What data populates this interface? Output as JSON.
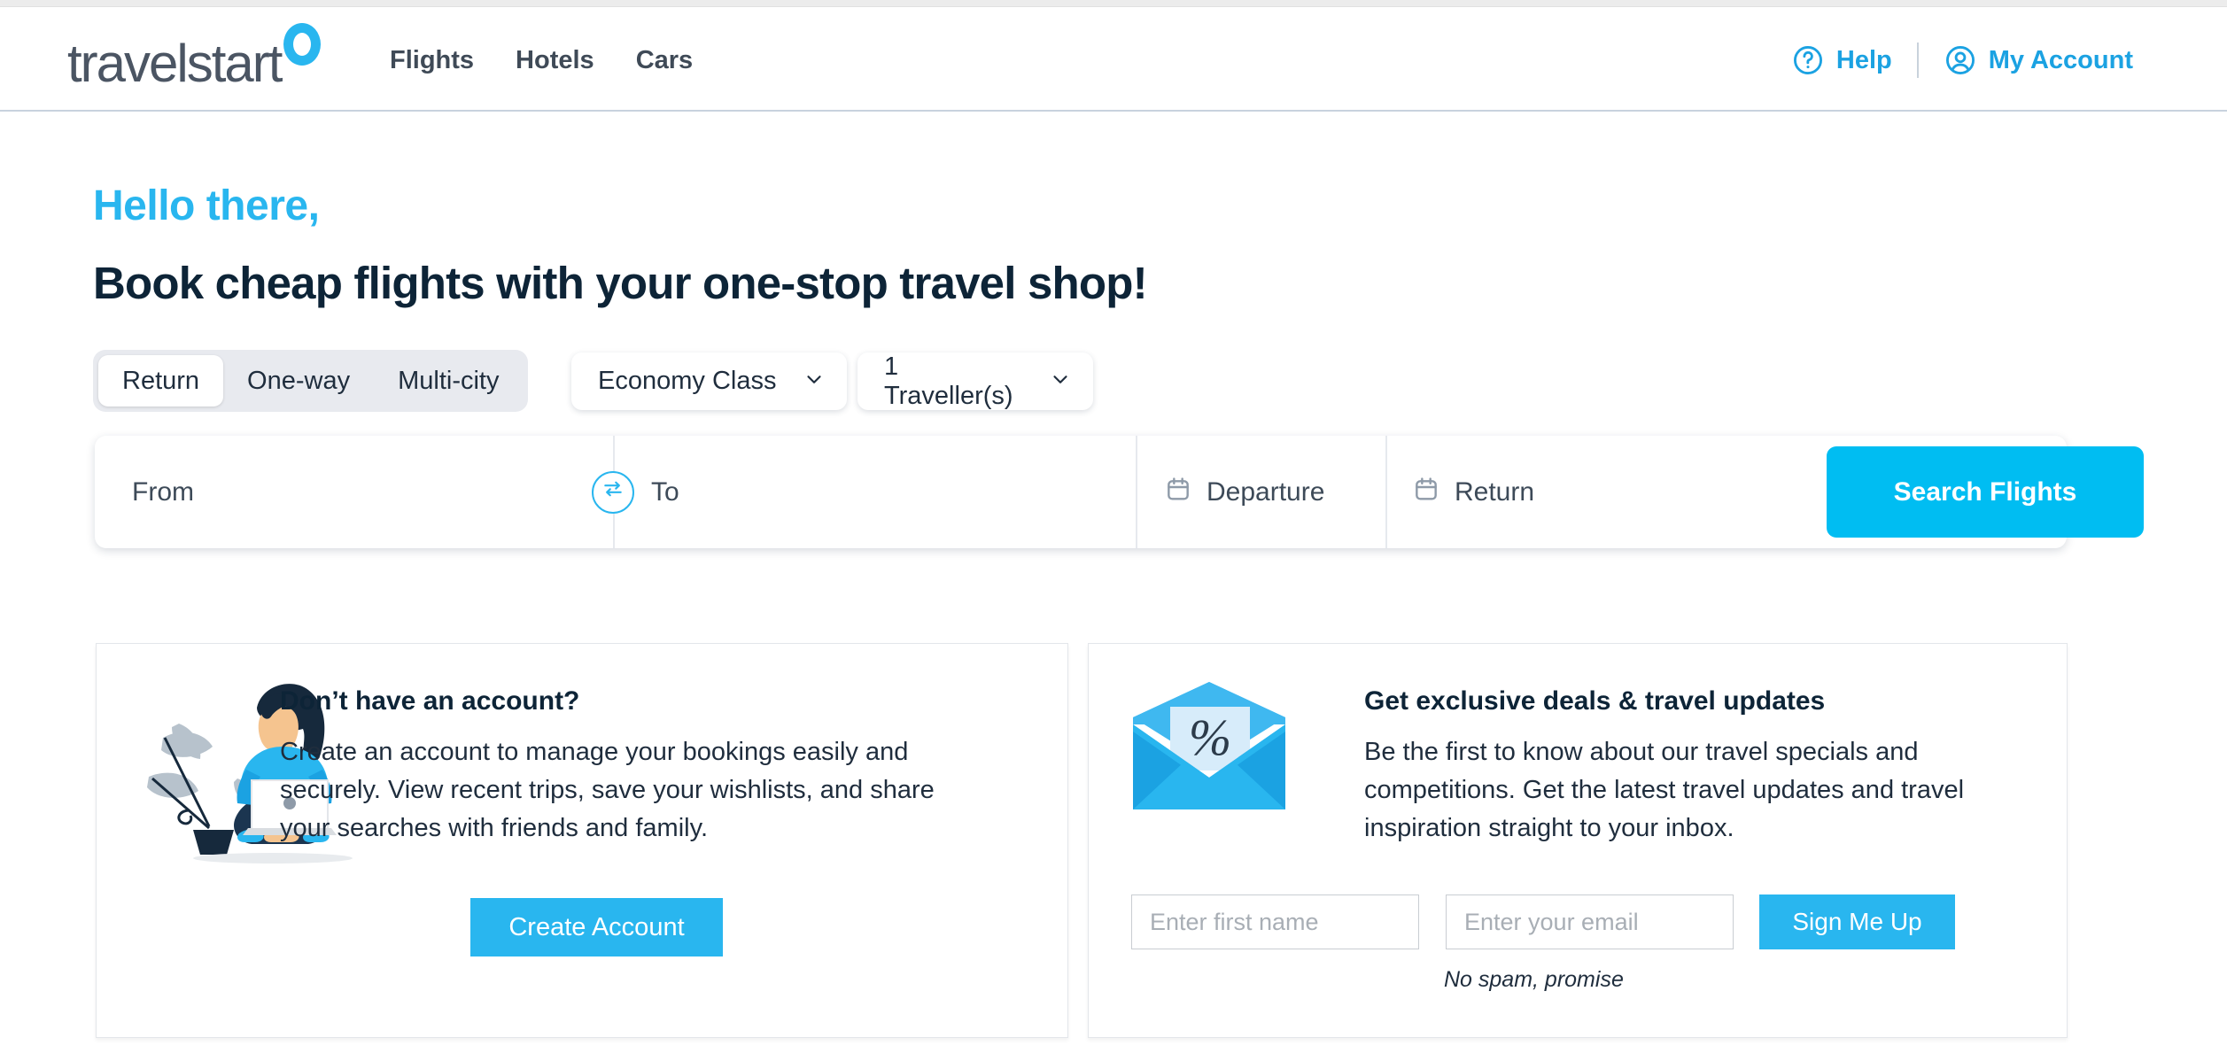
{
  "brand": {
    "logo_text": "travelstart",
    "accent_color": "#29b6ef",
    "accent_bright": "#00bdf2",
    "dark_color": "#0d2437"
  },
  "header": {
    "nav": [
      {
        "label": "Flights"
      },
      {
        "label": "Hotels"
      },
      {
        "label": "Cars"
      }
    ],
    "help": {
      "label": "Help",
      "icon": "question-circle-icon"
    },
    "account": {
      "label": "My Account",
      "icon": "user-circle-icon"
    }
  },
  "hero": {
    "greeting": "Hello there,",
    "headline": "Book cheap flights with your one-stop travel shop!"
  },
  "search": {
    "trip_types": [
      {
        "label": "Return",
        "active": true
      },
      {
        "label": "One-way",
        "active": false
      },
      {
        "label": "Multi-city",
        "active": false
      }
    ],
    "cabin_class": {
      "value": "Economy Class",
      "icon": "chevron-down-icon"
    },
    "travellers": {
      "value": "1 Traveller(s)",
      "icon": "chevron-down-icon"
    },
    "from": {
      "placeholder": "From"
    },
    "to": {
      "placeholder": "To"
    },
    "swap": {
      "icon": "swap-arrows-icon"
    },
    "departure": {
      "placeholder": "Departure",
      "icon": "calendar-icon"
    },
    "return": {
      "placeholder": "Return",
      "icon": "calendar-icon"
    },
    "search_button": "Search Flights"
  },
  "cards": {
    "account": {
      "illustration": "woman-with-laptop-illustration",
      "title": "Don’t have an account?",
      "body": "Create an account to manage your bookings easily and securely. View recent trips, save your wishlists, and share your searches with friends and family.",
      "button": "Create Account"
    },
    "newsletter": {
      "illustration": "envelope-percent-icon",
      "title": "Get exclusive deals & travel updates",
      "body": "Be the first to know about our travel specials and competitions. Get the latest travel updates and travel inspiration straight to your inbox.",
      "first_name_placeholder": "Enter first name",
      "first_name_value": "",
      "email_placeholder": "Enter your email",
      "email_value": "",
      "button": "Sign Me Up",
      "disclaimer": "No spam, promise"
    }
  }
}
